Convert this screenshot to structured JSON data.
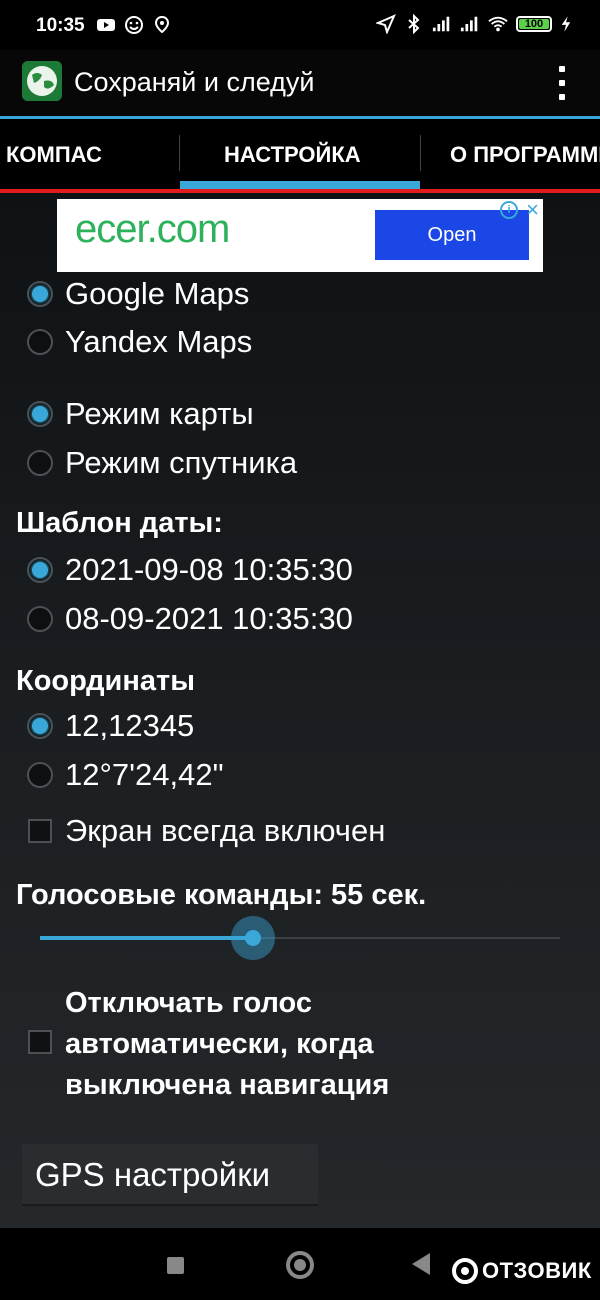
{
  "status_bar": {
    "time": "10:35",
    "battery": "100"
  },
  "app": {
    "title": "Сохраняй и следуй"
  },
  "tabs": [
    {
      "label": "КОМПАС",
      "selected": false
    },
    {
      "label": "НАСТРОЙКА",
      "selected": true
    },
    {
      "label": "О ПРОГРАММЕ",
      "selected": false
    }
  ],
  "ad": {
    "brand": "ecer.com",
    "button": "Open"
  },
  "map_provider": {
    "options": [
      {
        "label": "Google Maps",
        "selected": true
      },
      {
        "label": "Yandex Maps",
        "selected": false
      }
    ]
  },
  "map_mode": {
    "options": [
      {
        "label": "Режим карты",
        "selected": true
      },
      {
        "label": "Режим спутника",
        "selected": false
      }
    ]
  },
  "date_template": {
    "title": "Шаблон даты:",
    "options": [
      {
        "label": "2021-09-08 10:35:30",
        "selected": true
      },
      {
        "label": "08-09-2021 10:35:30",
        "selected": false
      }
    ]
  },
  "coordinates": {
    "title": "Координаты",
    "options": [
      {
        "label": "12,12345",
        "selected": true
      },
      {
        "label": "12°7'24,42\"",
        "selected": false
      }
    ]
  },
  "screen_always_on": {
    "label": "Экран всегда включен",
    "checked": false
  },
  "voice_commands": {
    "title": "Голосовые команды: 55 сек.",
    "slider_fraction": 0.41
  },
  "auto_voice_off": {
    "line1": "Отключать голос",
    "line2": "автоматически, когда",
    "line3": "выключена навигация",
    "checked": false
  },
  "gps_button": {
    "label": "GPS настройки"
  },
  "watermark": {
    "text": "ОТЗОВИК"
  },
  "colors": {
    "accent": "#39a7d8",
    "tab_underline_red": "#e11c1c",
    "ad_button": "#1a47e6",
    "ad_logo": "#2db15a"
  }
}
